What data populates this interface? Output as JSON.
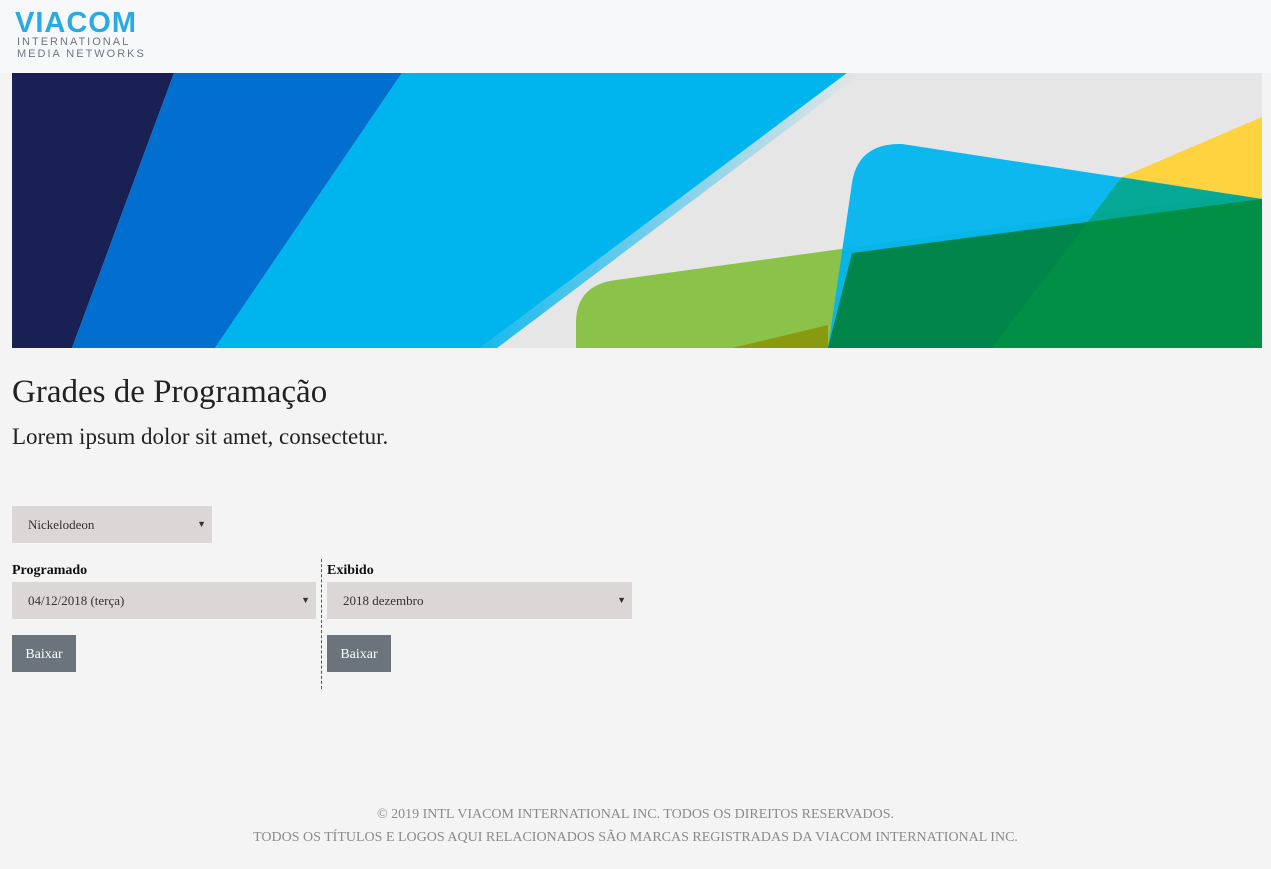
{
  "logo": {
    "brand": "VIACOM",
    "line1": "INTERNATIONAL",
    "line2": "MEDIA NETWORKS"
  },
  "page": {
    "title": "Grades de Programação",
    "subtitle": "Lorem ipsum dolor sit amet, consectetur."
  },
  "channel_select": {
    "value": "Nickelodeon"
  },
  "scheduled": {
    "label": "Programado",
    "date_value": "04/12/2018 (terça)",
    "button_label": "Baixar"
  },
  "aired": {
    "label": "Exibido",
    "month_value": "2018 dezembro",
    "button_label": "Baixar"
  },
  "footer": {
    "line1": "© 2019 INTL VIACOM INTERNATIONAL INC. TODOS OS DIREITOS RESERVADOS.",
    "line2": "TODOS OS TÍTULOS E LOGOS AQUI RELACIONADOS SÃO MARCAS REGISTRADAS DA VIACOM INTERNATIONAL INC."
  },
  "colors": {
    "brand_blue": "#2aaae2",
    "button_gray": "#6b737c",
    "select_bg": "#dad7d6",
    "hero_navy": "#182054",
    "hero_blue": "#006fcf",
    "hero_cyan": "#00b5ee",
    "hero_green": "#8bc34a",
    "hero_dark_green": "#007417",
    "hero_yellow": "#ffd33f"
  }
}
